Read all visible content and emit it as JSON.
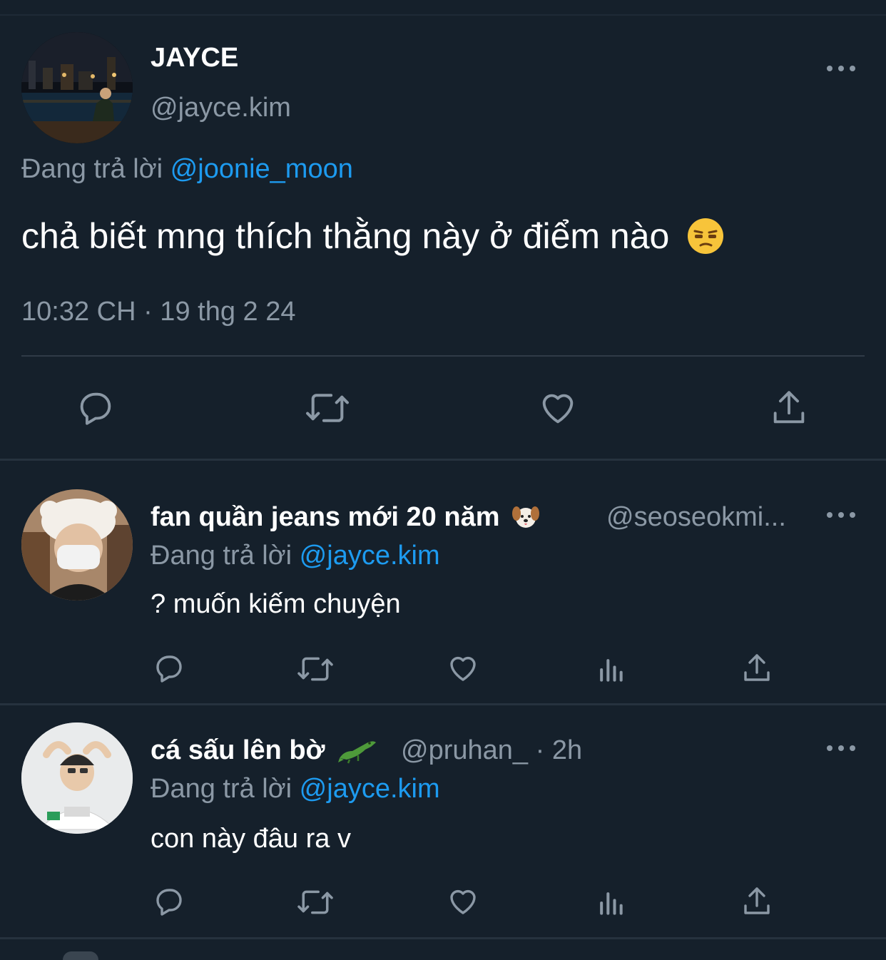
{
  "main_tweet": {
    "display_name": "JAYCE",
    "handle": "@jayce.kim",
    "reply_prefix": "Đang trả lời",
    "reply_to": "@joonie_moon",
    "text": "chả biết mng thích thằng này ở điểm nào",
    "emoji": "unamused-face",
    "timestamp": "10:32 CH · 19 thg 2 24",
    "actions": [
      "reply-icon",
      "retweet-icon",
      "like-icon",
      "share-icon"
    ]
  },
  "replies": [
    {
      "display_name": "fan quần jeans mới 20 năm",
      "name_emoji": "dog-face",
      "handle": "@seoseokmi...",
      "reply_prefix": "Đang trả lời",
      "reply_to": "@jayce.kim",
      "text": "? muốn kiếm chuyện"
    },
    {
      "display_name": "cá sấu lên bờ",
      "name_emoji": "crocodile",
      "handle": "@pruhan_",
      "time": "· 2h",
      "reply_prefix": "Đang trả lời",
      "reply_to": "@jayce.kim",
      "text": "con này đâu ra v"
    }
  ],
  "colors": {
    "background": "#15202b",
    "secondary_text": "#8b98a5",
    "link": "#1d9bf0",
    "icon": "#8b98a5"
  }
}
